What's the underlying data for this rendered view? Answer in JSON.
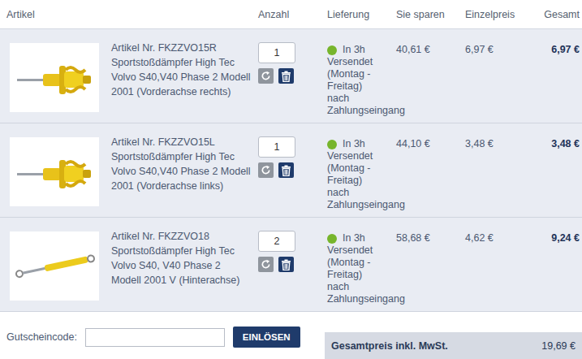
{
  "columns": [
    "Artikel",
    "Anzahl",
    "Lieferung",
    "Sie sparen",
    "Einzelpreis",
    "Gesamt"
  ],
  "rows": [
    {
      "title": "Artikel Nr. FKZZVO15R Sportstoßdämpfer High Tec Volvo S40,V40 Phase 2 Modell 2001 (Vorderachse rechts)",
      "quantity": "1",
      "delivery": [
        "In 3h",
        "Versendet",
        "(Montag -",
        "Freitag)",
        "nach",
        "Zahlungseingang"
      ],
      "savings": "40,61 €",
      "unit_price": "6,97 €",
      "total": "6,97 €",
      "kind": "front"
    },
    {
      "title": "Artikel Nr. FKZZVO15L Sportstoßdämpfer High Tec Volvo S40,V40 Phase 2 Modell 2001 (Vorderachse links)",
      "quantity": "1",
      "delivery": [
        "In 3h",
        "Versendet",
        "(Montag -",
        "Freitag)",
        "nach",
        "Zahlungseingang"
      ],
      "savings": "44,10 €",
      "unit_price": "3,48 €",
      "total": "3,48 €",
      "kind": "front"
    },
    {
      "title": "Artikel Nr. FKZZVO18 Sportstoßdämpfer High Tec Volvo S40, V40 Phase 2 Modell 2001 V (Hinterachse)",
      "quantity": "2",
      "delivery": [
        "In 3h",
        "Versendet",
        "(Montag -",
        "Freitag)",
        "nach",
        "Zahlungseingang"
      ],
      "savings": "58,68 €",
      "unit_price": "4,62 €",
      "total": "9,24 €",
      "kind": "rear"
    }
  ],
  "coupon": {
    "label": "Gutscheincode:",
    "button": "EINLÖSEN"
  },
  "total": {
    "label": "Gesamtpreis inkl. MwSt.",
    "value": "19,69 €"
  }
}
